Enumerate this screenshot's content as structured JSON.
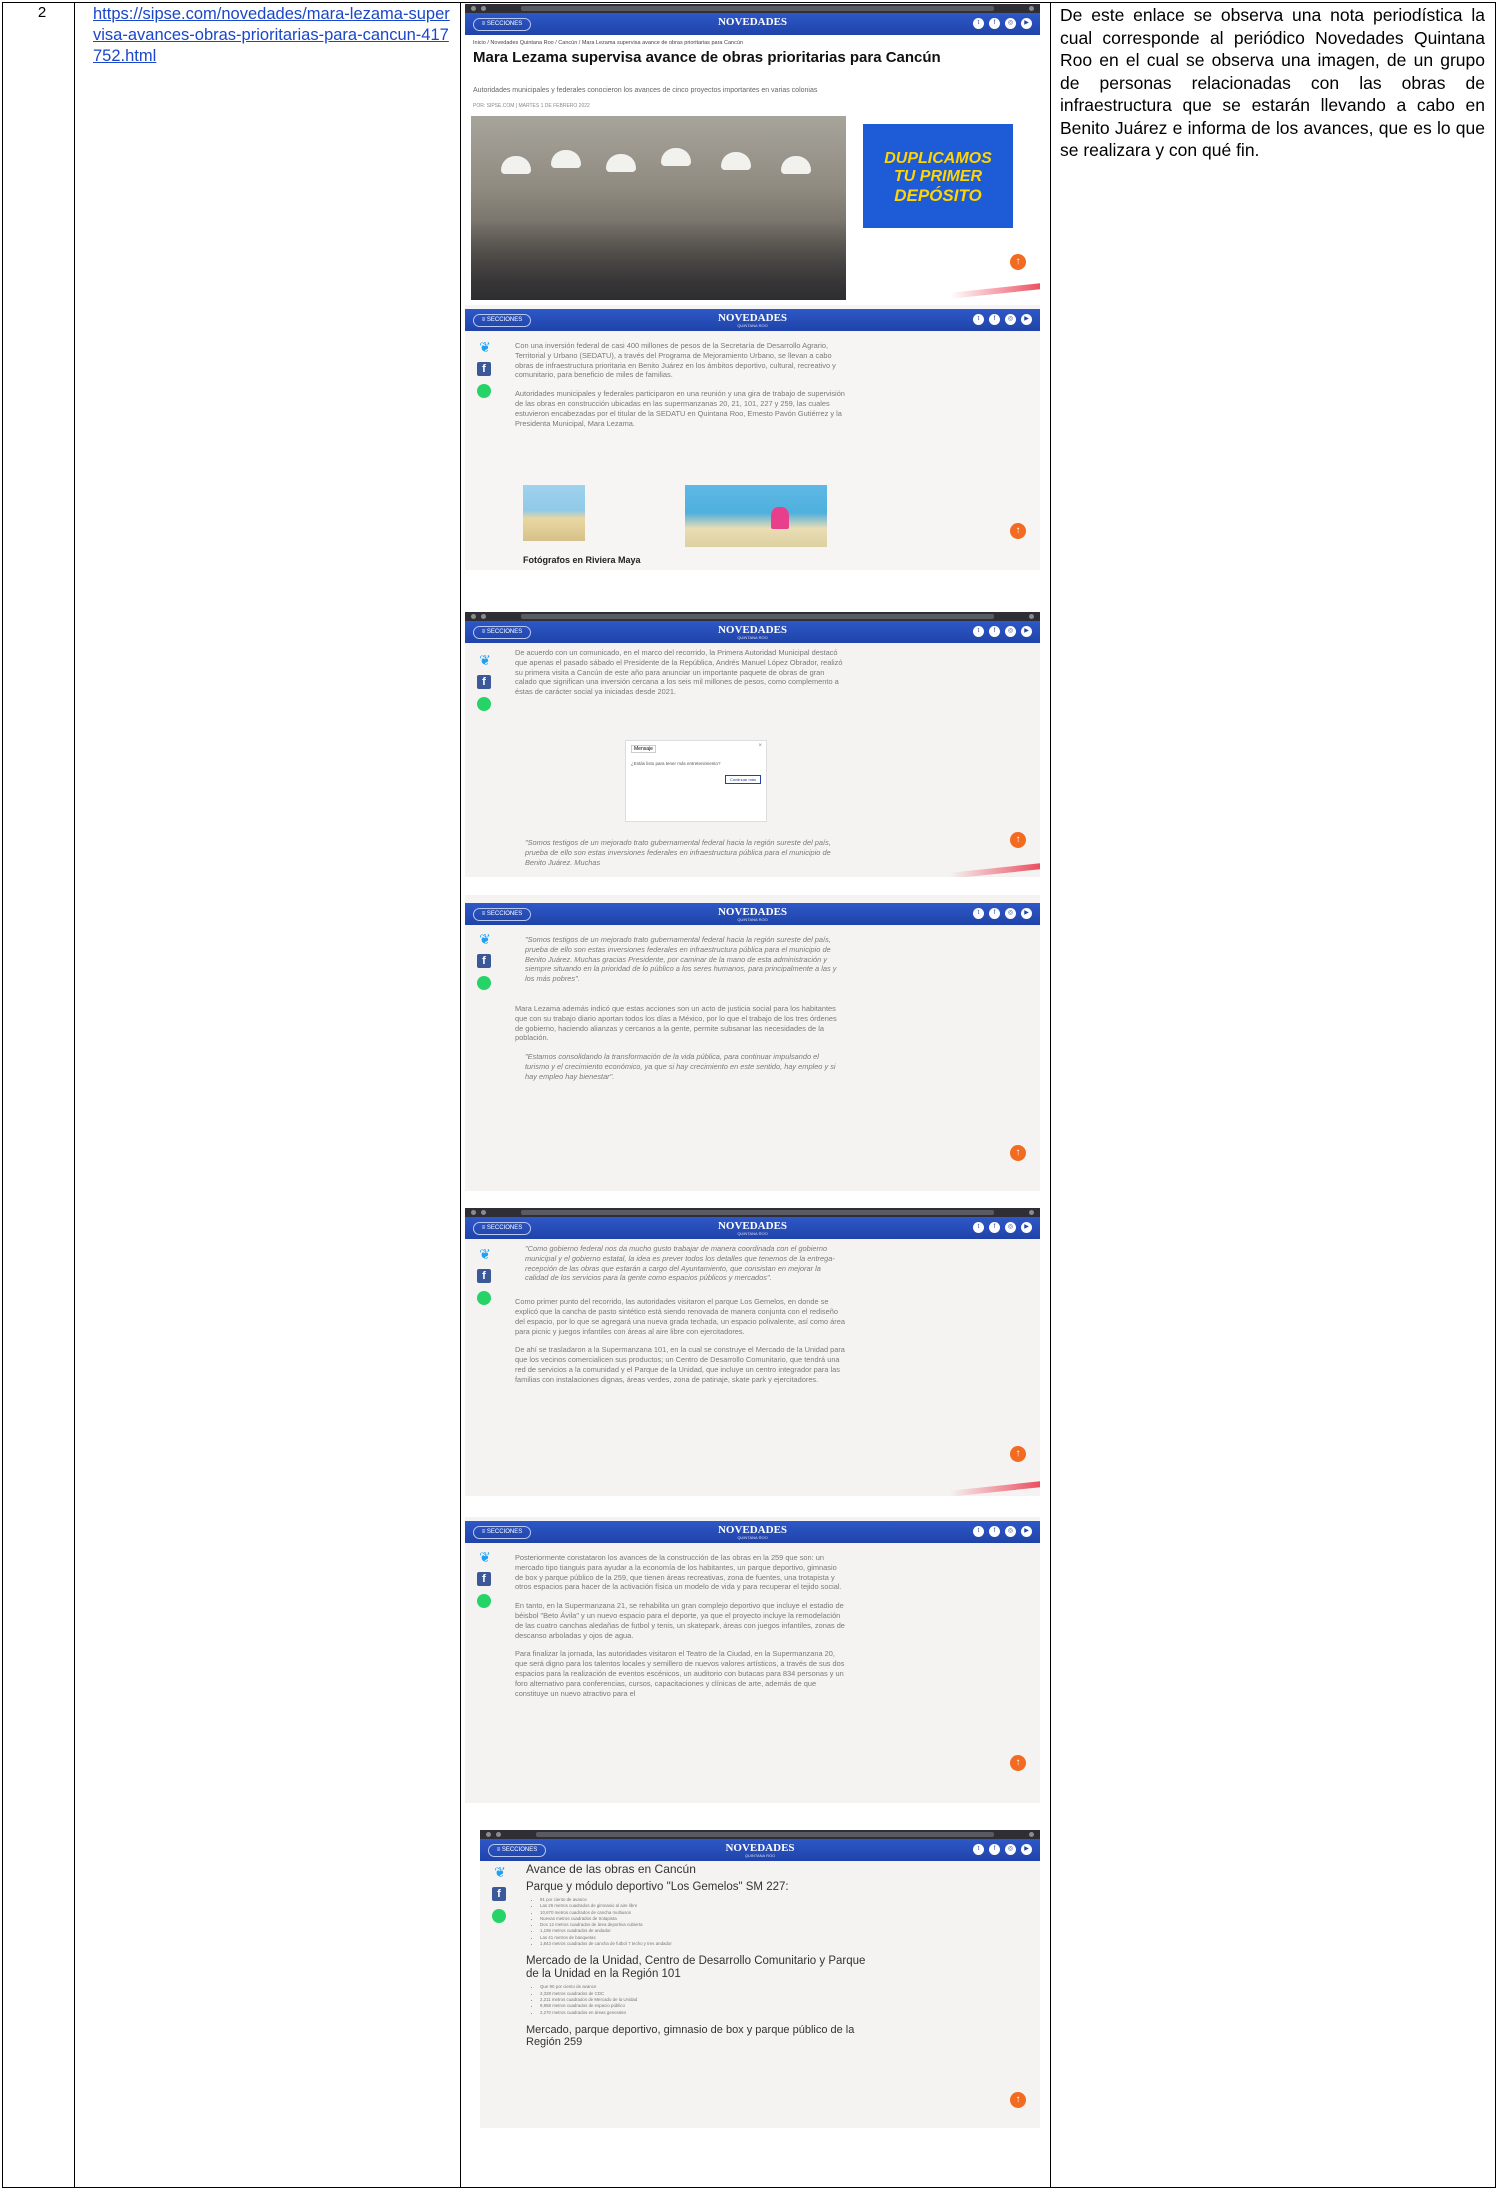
{
  "row": {
    "number": "2",
    "link": "https://sipse.com/novedades/mara-lezama-supervisa-avances-obras-prioritarias-para-cancun-417752.html",
    "description": "De este enlace se observa una nota periodística la cual corresponde al periódico Novedades Quintana Roo en el cual se observa una imagen, de un grupo de personas relacionadas con las obras de infraestructura que se estarán llevando a cabo en Benito Juárez e informa de los avances, que es lo que se realizara y con qué fin."
  },
  "site": {
    "sections_label": "≡ SECCIONES",
    "brand": "NOVEDADES",
    "brand_sub": "QUINTANA ROO",
    "social_icons": [
      "twitter-icon",
      "facebook-icon",
      "instagram-icon",
      "youtube-icon"
    ]
  },
  "shot1": {
    "breadcrumb": "Inicio / Novedades Quintana Roo / Cancún / Mara Lezama supervisa avance de obras prioritarias para Cancún",
    "headline": "Mara Lezama supervisa avance de obras prioritarias para Cancún",
    "subhead": "Autoridades municipales y federales conocieron los avances de cinco proyectos importantes en varias colonias",
    "byline": "POR: SIPSE.COM  |  MARTES 1 DE FEBRERO 2022",
    "ad_line1": "DUPLICAMOS",
    "ad_line2": "TU PRIMER",
    "ad_line3": "DEPÓSITO"
  },
  "shot2": {
    "p1": "Con una inversión federal de casi 400 millones de pesos de la Secretaría de Desarrollo Agrario, Territorial y Urbano (SEDATU), a través del Programa de Mejoramiento Urbano, se llevan a cabo obras de infraestructura prioritaria en Benito Juárez en los ámbitos deportivo, cultural, recreativo y comunitario, para beneficio de miles de familias.",
    "p2": "Autoridades municipales y federales participaron en una reunión y una gira de trabajo de supervisión de las obras en construcción ubicadas en las supermanzanas 20, 21, 101, 227 y 259, las cuales estuvieron encabezadas por el titular de la SEDATU en Quintana Roo, Ernesto Pavón Gutiérrez y la Presidenta Municipal, Mara Lezama.",
    "ad_caption": "Fotógrafos en Riviera Maya"
  },
  "shot3": {
    "p1": "De acuerdo con un comunicado, en el marco del recorrido, la Primera Autoridad Municipal destacó que apenas el pasado sábado el Presidente de la República, Andrés Manuel López Obrador, realizó su primera visita a Cancún de este año para anunciar un importante paquete de obras de gran calado que significan una inversión cercana a los seis mil millones de pesos, como complemento a éstas de carácter social ya iniciadas desde 2021.",
    "dialog_title": "Mensaje",
    "dialog_q": "¿Estás listo para tener más entretenimiento?",
    "dialog_btn": "Continuar más",
    "quote": "\"Somos testigos de un mejorado trato gubernamental federal hacia la región sureste del país, prueba de ello son estas inversiones federales en infraestructura pública para el municipio de Benito Juárez. Muchas"
  },
  "shot4": {
    "quote1": "\"Somos testigos de un mejorado trato gubernamental federal hacia la región sureste del país, prueba de ello son estas inversiones federales en infraestructura pública para el municipio de Benito Juárez. Muchas gracias Presidente, por caminar de la mano de esta administración y siempre situando en la prioridad de lo público a los seres humanos, para principalmente a las y los más pobres\".",
    "p2": "Mara Lezama además indicó que estas acciones son un acto de justicia social para los habitantes que con su trabajo diario aportan todos los días a México, por lo que el trabajo de los tres órdenes de gobierno, haciendo alianzas y cercanos a la gente, permite subsanar las necesidades de la población.",
    "quote2": "\"Estamos consolidando la transformación de la vida pública, para continuar impulsando el turismo y el crecimiento económico, ya que si hay crecimiento en este sentido, hay empleo y si hay empleo hay bienestar\"."
  },
  "shot5": {
    "quote": "\"Como gobierno federal nos da mucho gusto trabajar de manera coordinada con el gobierno municipal y el gobierno estatal, la idea es prever todos los detalles que tenemos de la entrega-recepción de las obras que estarán a cargo del Ayuntamiento, que consistan en mejorar la calidad de los servicios para la gente como espacios públicos y mercados\".",
    "p2": "Como primer punto del recorrido, las autoridades visitaron el parque Los Gemelos, en donde se explicó que la cancha de pasto sintético está siendo renovada de manera conjunta con el rediseño del espacio, por lo que se agregará una nueva grada techada, un espacio polivalente, así como área para picnic y juegos infantiles con áreas al aire libre con ejercitadores.",
    "p3": "De ahí se trasladaron a la Supermanzana 101, en la cual se construye el Mercado de la Unidad para que los vecinos comercialicen sus productos; un Centro de Desarrollo Comunitario, que tendrá una red de servicios a la comunidad y el Parque de la Unidad, que incluye un centro integrador para las familias con instalaciones dignas, áreas verdes, zona de patinaje, skate park y ejercitadores."
  },
  "shot6": {
    "p1": "Posteriormente constataron los avances de la construcción de las obras en la 259 que son: un mercado tipo tianguis para ayudar a la economía de los habitantes, un parque deportivo, gimnasio de box y parque público de la 259, que tienen áreas recreativas, zona de fuentes, una trotapista y otros espacios para hacer de la activación física un modelo de vida y para recuperar el tejido social.",
    "p2": "En tanto, en la Supermanzana 21, se rehabilita un gran complejo deportivo que incluye el estadio de béisbol \"Beto Ávila\" y un nuevo espacio para el deporte, ya que el proyecto incluye la remodelación de las cuatro canchas aledañas de futbol y tenis, un skatepark, áreas con juegos infantiles, zonas de descanso arboladas y ojos de agua.",
    "p3": "Para finalizar la jornada, las autoridades visitaron el Teatro de la Ciudad, en la Supermanzana 20, que será digno para los talentos locales y semillero de nuevos valores artísticos, a través de sus dos espacios para la realización de eventos escénicos, un auditorio con butacas para 834 personas y un foro alternativo para conferencias, cursos, capacitaciones y clínicas de arte, además de que constituye un nuevo atractivo para el"
  },
  "shot7": {
    "h1": "Avance de las obras en Cancún",
    "h2": "Parque y módulo deportivo \"Los Gemelos\" SM 227:",
    "list1": [
      "91 por ciento de avance",
      "Las 26 metros cuadrados de gimnasio al aire libre",
      "10,670 metros cuadrados de cancha multiusos",
      "Nuevas metros cuadrados de trotapista",
      "Dos 12 metros cuadrados de área deportiva cubierta",
      "1,195 metros cuadrados de andador",
      "Las 41 metros de banquetas",
      "1,843 metros cuadrados de cancha de futbol 7 techo y tres andador"
    ],
    "h3": "Mercado de la Unidad, Centro de Desarrollo Comunitario y Parque de la Unidad en la Región 101",
    "list2": [
      "Que 90 por ciento de avance",
      "2,328 metros cuadrados de CDC",
      "2,211 metros cuadrados de Mercado de la Unidad",
      "9,958 metros cuadrados de espacio público",
      "2,270 metros cuadrados en áreas generales"
    ],
    "h4": "Mercado, parque deportivo, gimnasio de box y parque público de la Región 259"
  }
}
